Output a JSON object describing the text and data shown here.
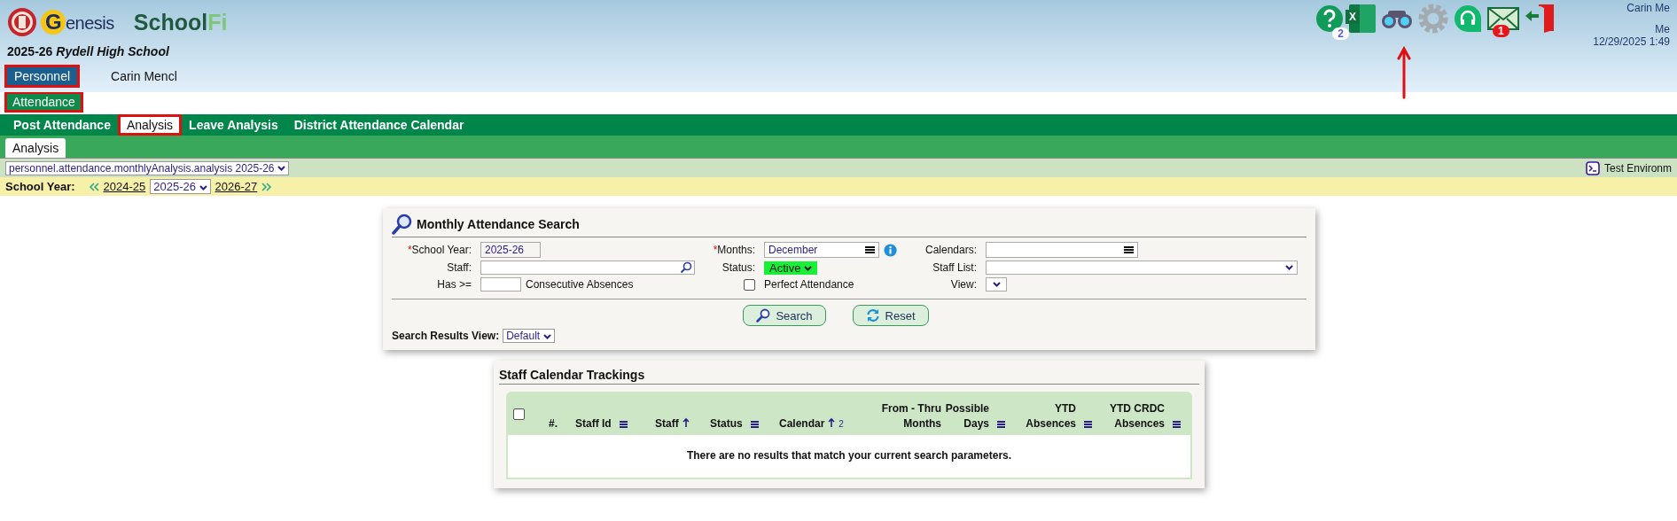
{
  "header": {
    "brand": {
      "genesis_text": "enesis",
      "genesis_initial": "G",
      "schoolfi_dark": "School",
      "schoolfi_light": "Fi"
    },
    "school": {
      "year": "2025-26",
      "name": "Rydell High School"
    },
    "icons": [
      {
        "kind": "help",
        "badge": "2"
      },
      {
        "kind": "excel",
        "badge_text": "X"
      },
      {
        "kind": "binoculars"
      },
      {
        "kind": "settings"
      },
      {
        "kind": "support"
      },
      {
        "kind": "mail",
        "badge": "1"
      },
      {
        "kind": "logout"
      }
    ],
    "user": {
      "name": "Carin Me",
      "line_2": "Me",
      "datetime": "12/29/2025 1:49"
    }
  },
  "annotation": {
    "arrow_shown": true
  },
  "module_tabs": [
    {
      "label": "Personnel",
      "selected": true,
      "highlighted": true
    },
    {
      "label": "Carin Mencl",
      "selected": false,
      "highlighted": false
    }
  ],
  "section_tabs": [
    {
      "label": "Attendance",
      "selected": true,
      "highlighted": true
    }
  ],
  "nav": [
    {
      "label": "Post Attendance",
      "selected": false,
      "highlighted": false
    },
    {
      "label": "Analysis",
      "selected": true,
      "highlighted": true
    },
    {
      "label": "Leave Analysis",
      "selected": false,
      "highlighted": false
    },
    {
      "label": "District Attendance Calendar",
      "selected": false,
      "highlighted": false
    }
  ],
  "sub_tabs": [
    {
      "label": "Analysis",
      "selected": true
    }
  ],
  "screen_select": {
    "value": "personnel.attendance.monthlyAnalysis.analysis 2025-26"
  },
  "environment": {
    "label": "Test Environm"
  },
  "school_year_bar": {
    "label": "School Year:",
    "previous": "2024-25",
    "current": "2025-26",
    "next": "2026-27"
  },
  "search": {
    "title": "Monthly Attendance Search",
    "school_year": {
      "required_mark": "*",
      "label": "School Year:",
      "value": "2025-26"
    },
    "months": {
      "required_mark": "*",
      "label": "Months:",
      "value": "December"
    },
    "calendars": {
      "label": "Calendars:"
    },
    "staff": {
      "label": "Staff:"
    },
    "status": {
      "label": "Status:",
      "value": "Active"
    },
    "staff_list": {
      "label": "Staff List:"
    },
    "has": {
      "label": "Has >=",
      "suffix": "Consecutive Absences"
    },
    "perfect_attendance": {
      "label": "Perfect Attendance",
      "checked": false
    },
    "view": {
      "label": "View:"
    },
    "buttons": [
      {
        "kind": "search",
        "label": "Search"
      },
      {
        "kind": "reset",
        "label": "Reset"
      }
    ],
    "results_view": {
      "label": "Search Results View:",
      "value": "Default"
    }
  },
  "trackings": {
    "title": "Staff Calendar Trackings",
    "select_all": {
      "checked": false
    },
    "columns": [
      {
        "label": "#.",
        "kind": "plain"
      },
      {
        "label": "Staff Id",
        "kind": "menu"
      },
      {
        "label": "Staff",
        "kind": "sorted"
      },
      {
        "label": "Status",
        "kind": "menu"
      },
      {
        "label": "Calendar",
        "kind": "sorted",
        "order": "2"
      },
      {
        "label": "From - Thru Months",
        "kind": "plain"
      },
      {
        "label": "Possible Days",
        "kind": "menu"
      },
      {
        "label": "YTD Absences",
        "kind": "menu"
      },
      {
        "label": "YTD CRDC Absences",
        "kind": "menu"
      }
    ],
    "empty_message": "There are no results that match your current search parameters."
  }
}
